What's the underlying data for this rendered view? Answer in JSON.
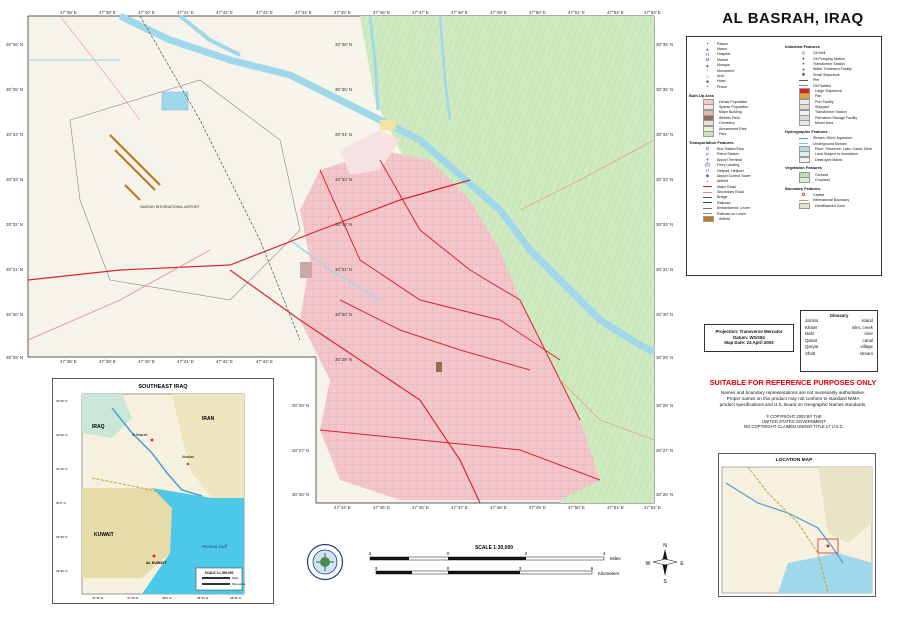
{
  "title": "AL BASRAH, IRAQ",
  "map_ticks": {
    "top_lon": [
      "47°38' E",
      "47°39' E",
      "47°40' E",
      "47°41' E",
      "47°42' E",
      "47°43' E",
      "47°44' E",
      "47°45' E",
      "47°46' E",
      "47°47' E",
      "47°48' E",
      "47°49' E",
      "47°50' E",
      "47°51' E",
      "47°52' E",
      "47°53' E"
    ],
    "mid_lon": [
      "47°38' E",
      "47°39' E",
      "47°40' E",
      "47°41' E",
      "47°42' E",
      "47°43' E"
    ],
    "bottom_lon": [
      "47°44' E",
      "47°45' E",
      "47°46' E",
      "47°47' E",
      "47°48' E",
      "47°49' E",
      "47°50' E",
      "47°51' E",
      "47°52' E",
      "47°53' E"
    ],
    "left_lat": [
      "30°36' N",
      "30°35' N",
      "30°34' N",
      "30°33' N",
      "30°32' N",
      "30°31' N",
      "30°30' N",
      "30°29' N"
    ],
    "right_lat": [
      "30°36' N",
      "30°35' N",
      "30°34' N",
      "30°33' N",
      "30°32' N",
      "30°31' N",
      "30°30' N",
      "30°29' N",
      "30°28' N",
      "30°27' N",
      "30°26' N"
    ],
    "inner_lat": [
      "30°36' N",
      "30°35' N",
      "30°34' N",
      "30°33' N",
      "30°32' N",
      "30°31' N",
      "30°30' N",
      "30°29' N"
    ],
    "lower_left_lat": [
      "30°28' N",
      "30°27' N",
      "30°26' N"
    ]
  },
  "map_labels": {
    "airport": "BASRAH INTERNATIONAL AIRPORT"
  },
  "legend": {
    "col1": [
      {
        "type": "sym",
        "glyph": "•",
        "color": "#7a3fa0",
        "label": "Palace"
      },
      {
        "type": "sym",
        "glyph": "●",
        "color": "#5a4aa0",
        "label": "Manor"
      },
      {
        "type": "sym",
        "glyph": "H",
        "color": "#3355cc",
        "label": "Hospital"
      },
      {
        "type": "sym",
        "glyph": "M",
        "color": "#aa2266",
        "label": "Market"
      },
      {
        "type": "sym",
        "glyph": "▲",
        "color": "#7a3fa0",
        "label": "Mosque"
      },
      {
        "type": "sym",
        "glyph": "i",
        "color": "#7a3fa0",
        "label": "Monument"
      },
      {
        "type": "sym",
        "glyph": "∩",
        "color": "#7a3fa0",
        "label": "Arch"
      },
      {
        "type": "sym",
        "glyph": "■",
        "color": "#3355cc",
        "label": "Hotel"
      },
      {
        "type": "sym",
        "glyph": "▪",
        "color": "#7a3fa0",
        "label": "Prison"
      },
      {
        "type": "head",
        "label": "Built-Up Area"
      },
      {
        "type": "sw",
        "color": "#f0c8c8",
        "label": "Dense Population"
      },
      {
        "type": "sw",
        "color": "#f8e2e2",
        "label": "Sparse Population"
      },
      {
        "type": "sw",
        "color": "#e0b8b8",
        "label": "Major Building"
      },
      {
        "type": "sw",
        "color": "#9a6a50",
        "label": "Athletic Field"
      },
      {
        "type": "sw",
        "color": "#e8e0d0",
        "label": "Cemetery"
      },
      {
        "type": "sw",
        "color": "#e8f0d8",
        "label": "Amusement Park"
      },
      {
        "type": "sw",
        "color": "#c8e6b0",
        "label": "Park"
      },
      {
        "type": "head",
        "label": "Transportation Features"
      },
      {
        "type": "sym",
        "glyph": "B",
        "color": "#3355cc",
        "label": "Bus Station/Stop"
      },
      {
        "type": "sym",
        "glyph": "P",
        "color": "#3355cc",
        "label": "Petrol Station"
      },
      {
        "type": "sym",
        "glyph": "✈",
        "color": "#3355cc",
        "label": "Airport Terminal"
      },
      {
        "type": "sym",
        "glyph": "⛴",
        "color": "#3355cc",
        "label": "Ferry Landing"
      },
      {
        "type": "sym",
        "glyph": "H",
        "color": "#7a3fa0",
        "label": "Helipad; Heliport"
      },
      {
        "type": "sym",
        "glyph": "◆",
        "color": "#7a3fa0",
        "label": "Airport Control Tower"
      },
      {
        "type": "sym",
        "glyph": "+",
        "color": "#3355cc",
        "label": "Airfield"
      },
      {
        "type": "line",
        "color": "#cc2222",
        "label": "Major Road"
      },
      {
        "type": "line",
        "color": "#e88888",
        "label": "Secondary Road"
      },
      {
        "type": "line",
        "color": "#555555",
        "label": "Bridge"
      },
      {
        "type": "line",
        "color": "#444444",
        "label": "Railroad"
      },
      {
        "type": "line",
        "color": "#777777",
        "label": "Embankment; Levee"
      },
      {
        "type": "line",
        "color": "#888888",
        "label": "Railroad on Levee"
      },
      {
        "type": "sw",
        "color": "#c07a20",
        "label": "Airfield"
      }
    ],
    "col2": [
      {
        "type": "head",
        "label": "Industrial Features"
      },
      {
        "type": "sym",
        "glyph": "◎",
        "color": "#7a3fa0",
        "label": "Oil Well"
      },
      {
        "type": "sym",
        "glyph": "●",
        "color": "#cc2222",
        "label": "Oil Pumping Station"
      },
      {
        "type": "sym",
        "glyph": "●",
        "color": "#3a7a3a",
        "label": "Transformer Station"
      },
      {
        "type": "sym",
        "glyph": "●",
        "color": "#3355cc",
        "label": "Water Treatment Facility"
      },
      {
        "type": "sym",
        "glyph": "✱",
        "color": "#444444",
        "label": "Small Shipwreck"
      },
      {
        "type": "line",
        "color": "#555555",
        "label": "Pier"
      },
      {
        "type": "line",
        "color": "#888888",
        "label": "Oil Pipeline"
      },
      {
        "type": "sw",
        "color": "#e02020",
        "label": "Large Shipwreck"
      },
      {
        "type": "sw",
        "color": "#f0a020",
        "label": "Pan"
      },
      {
        "type": "sw",
        "color": "#e8e8e8",
        "label": "Port Facility"
      },
      {
        "type": "sw",
        "color": "#dcdcdc",
        "label": "Shipyard"
      },
      {
        "type": "sw",
        "color": "#f0f0f0",
        "label": "Transformer Station"
      },
      {
        "type": "sw",
        "color": "#d8d8d8",
        "label": "Petroleum Storage Facility"
      },
      {
        "type": "sw",
        "color": "#eaeaea",
        "label": "Mined Area"
      },
      {
        "type": "head",
        "label": "Hydrographic Features"
      },
      {
        "type": "line",
        "color": "#3aa0d0",
        "label": "Stream; Ditch; Aqueduct"
      },
      {
        "type": "line",
        "color": "#7ac0e0",
        "label": "Underground Stream"
      },
      {
        "type": "sw",
        "color": "#a8dcef",
        "label": "River; Reservoir; Lake; Canal; Ditch"
      },
      {
        "type": "sw",
        "color": "#e0f0e8",
        "label": "Land Subject to Inundation"
      },
      {
        "type": "sw",
        "color": "#f0f0f0",
        "label": "Destroyed Marsh"
      },
      {
        "type": "head",
        "label": "Vegetation Features"
      },
      {
        "type": "sw",
        "color": "#b8e0a8",
        "label": "Orchard"
      },
      {
        "type": "sw",
        "color": "#e0f0d8",
        "label": "Cropland"
      },
      {
        "type": "head",
        "label": "Boundary Features"
      },
      {
        "type": "sym",
        "glyph": "✪",
        "color": "#cc2222",
        "label": "Capital"
      },
      {
        "type": "line",
        "color": "#c8a040",
        "label": "International Boundary"
      },
      {
        "type": "sw",
        "color": "#e8e0c8",
        "label": "Demilitarized Zone"
      }
    ]
  },
  "projection": {
    "line1": "Projection: Transverse Mercator",
    "line2": "Datum: WGS84",
    "line3": "Map Date: 24 April 2003"
  },
  "glossary": {
    "heading": "Glossary",
    "rows": [
      {
        "term": "Jazirat",
        "meaning": "island"
      },
      {
        "term": "Khawr",
        "meaning": "inlet, creek"
      },
      {
        "term": "Nahr",
        "meaning": "river"
      },
      {
        "term": "Qanat",
        "meaning": "canal"
      },
      {
        "term": "Qaryat",
        "meaning": "village"
      },
      {
        "term": "Shatt",
        "meaning": "stream"
      }
    ]
  },
  "suitable": "SUITABLE FOR REFERENCE PURPOSES ONLY",
  "notes": {
    "line1": "Names and boundary representations are not necessarily authoritative.",
    "line2": "Proper names on this product may not conform to standard NIMA",
    "line3": "product specifications and U.S. Board on Geographic Names standards."
  },
  "copyright": {
    "line1": "© COPYRIGHT 2003 BY THE",
    "line2": "UNITED STATES GOVERNMENT",
    "line3": "NO COPYRIGHT CLAIMED UNDER TITLE 17 U.S.C."
  },
  "location_map": {
    "title": "LOCATION MAP"
  },
  "inset": {
    "title": "SOUTHEAST IRAQ",
    "iraq": "IRAQ",
    "iran": "IRAN",
    "kuwait": "KUWAIT",
    "gulf": "Persian Gulf",
    "al_basrah": "Al Basrah",
    "abadan": "Abadan",
    "al_kuwayt": "AL KUWAYT",
    "scale_label": "SCALE 1:1,000,000",
    "miles": "Miles",
    "km": "Kilometers",
    "lat_ticks": [
      "30°45' N",
      "30°30' N",
      "30°15' N",
      "30°0' N",
      "29°45' N",
      "29°30' N"
    ],
    "lon_ticks": [
      "47°30' E",
      "47°45' E",
      "48°0' E",
      "48°15' E",
      "48°30' E"
    ]
  },
  "scale_bar": {
    "label": "SCALE 1:30,000",
    "miles_ticks": [
      "2",
      "0",
      "2",
      "4"
    ],
    "miles_unit": "Miles",
    "km_ticks": [
      "3",
      "0",
      "3",
      "6"
    ],
    "km_unit": "Kilometers"
  },
  "compass": {
    "n": "N",
    "s": "S",
    "e": "E",
    "w": "W"
  },
  "colors": {
    "water": "#9fd8ea",
    "urban": "#f3c6cb",
    "urban_light": "#f7e1e3",
    "green": "#cfeac0",
    "road_major": "#d9262c",
    "road_minor": "#e88a8a",
    "title_red": "#e00000"
  }
}
